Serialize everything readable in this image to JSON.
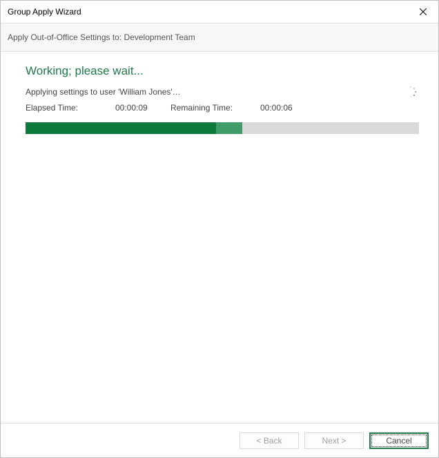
{
  "window": {
    "title": "Group Apply Wizard"
  },
  "subheader": {
    "text": "Apply Out-of-Office Settings to: Development Team"
  },
  "main": {
    "heading": "Working; please wait...",
    "status": "Applying settings to user 'William Jones'…",
    "elapsed_label": "Elapsed Time:",
    "elapsed_value": "00:00:09",
    "remaining_label": "Remaining Time:",
    "remaining_value": "00:00:06",
    "progress_percent": 55
  },
  "footer": {
    "back_label": "< Back",
    "next_label": "Next >",
    "cancel_label": "Cancel"
  },
  "colors": {
    "accent_green": "#1e7a4a",
    "progress_fill": "#0f7a3e",
    "progress_glow": "#3f9d6a",
    "progress_bg": "#d9d9d9"
  }
}
